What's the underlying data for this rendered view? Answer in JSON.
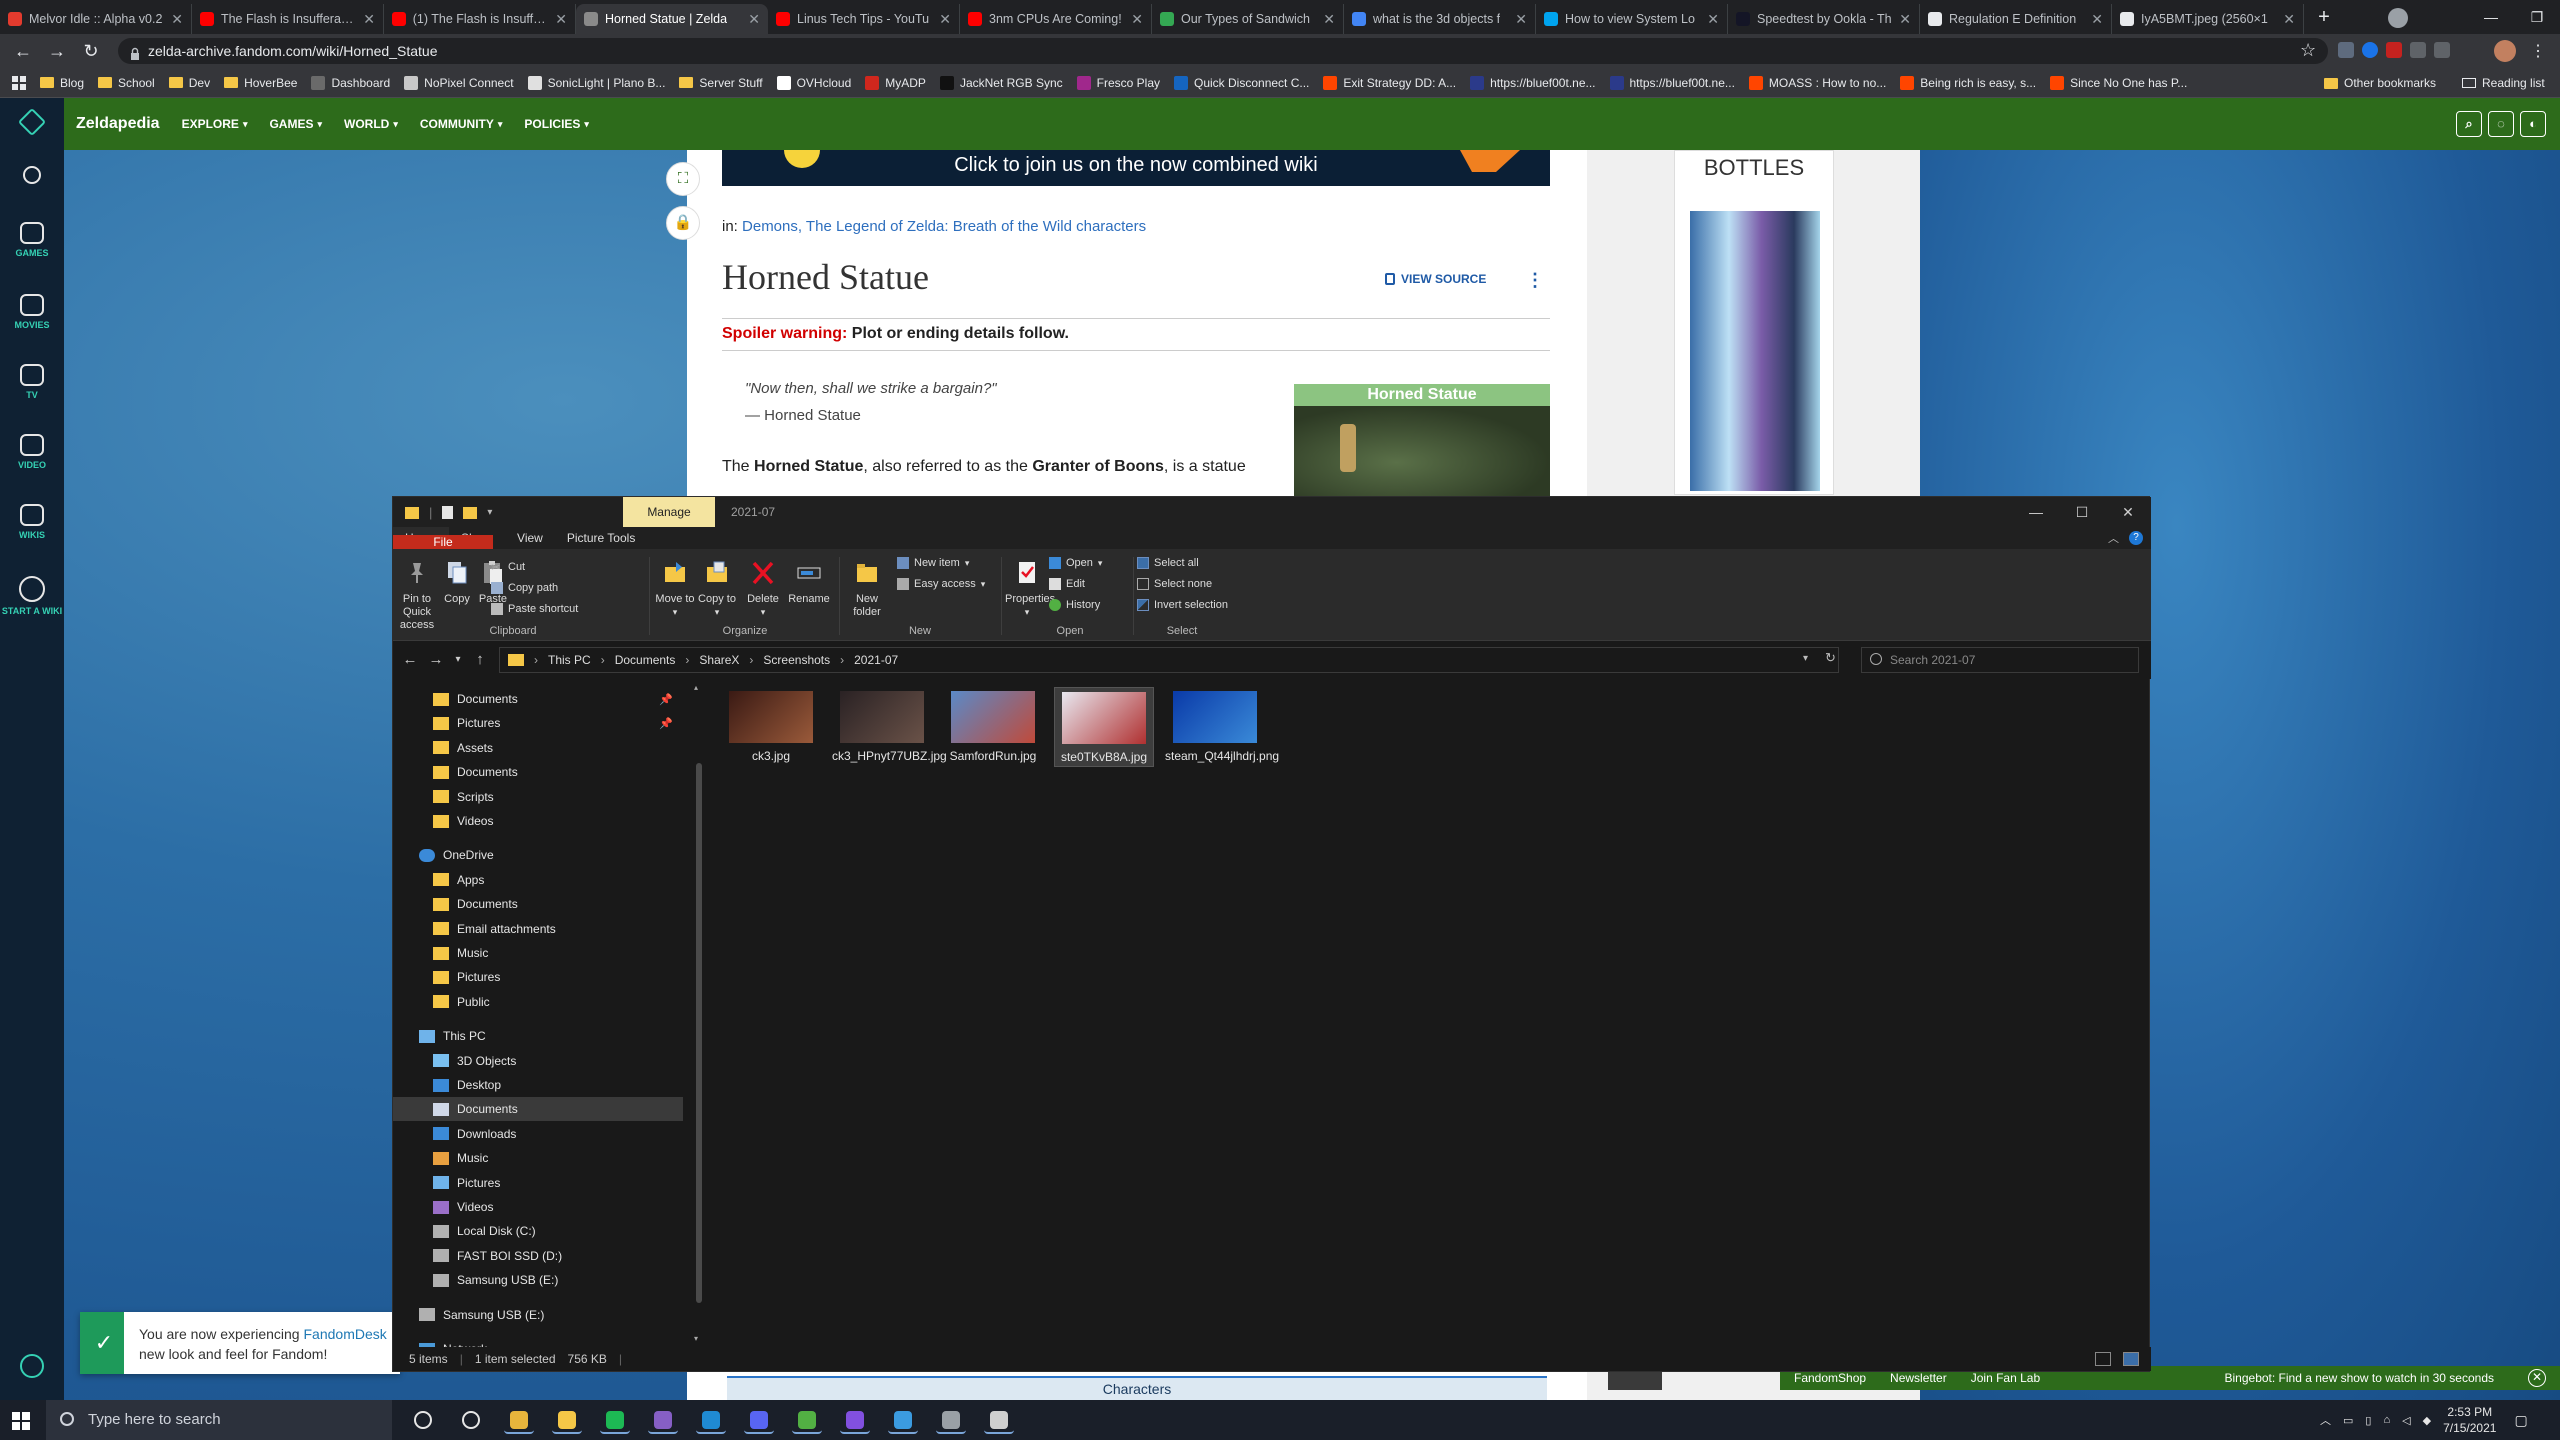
{
  "browser": {
    "tabs": [
      {
        "title": "Melvor Idle :: Alpha v0.2",
        "color": "#e33b2e",
        "active": false
      },
      {
        "title": "The Flash is Insufferably",
        "color": "#ff0000",
        "active": false
      },
      {
        "title": "(1) The Flash is Insuffera",
        "color": "#ff0000",
        "active": false
      },
      {
        "title": "Horned Statue | Zelda",
        "color": "#8a8a8a",
        "active": true
      },
      {
        "title": "Linus Tech Tips - YouTu",
        "color": "#ff0000",
        "active": false
      },
      {
        "title": "3nm CPUs Are Coming!",
        "color": "#ff0000",
        "active": false
      },
      {
        "title": "Our Types of Sandwich",
        "color": "#34a853",
        "active": false
      },
      {
        "title": "what is the 3d objects f",
        "color": "#4285f4",
        "active": false
      },
      {
        "title": "How to view System Lo",
        "color": "#00a4ef",
        "active": false
      },
      {
        "title": "Speedtest by Ookla - Th",
        "color": "#141526",
        "active": false
      },
      {
        "title": "Regulation E Definition",
        "color": "#e8eaed",
        "active": false
      },
      {
        "title": "IyA5BMT.jpeg (2560×1",
        "color": "#e8eaed",
        "active": false
      }
    ],
    "url": "zelda-archive.fandom.com/wiki/Horned_Statue",
    "bookmarks": [
      {
        "label": "Blog",
        "type": "folder"
      },
      {
        "label": "School",
        "type": "folder"
      },
      {
        "label": "Dev",
        "type": "folder"
      },
      {
        "label": "HoverBee",
        "type": "folder"
      },
      {
        "label": "Dashboard",
        "type": "site",
        "color": "#6a6a6a"
      },
      {
        "label": "NoPixel Connect",
        "type": "site",
        "color": "#c8c8c8"
      },
      {
        "label": "SonicLight | Plano B...",
        "type": "site",
        "color": "#e0e0e0"
      },
      {
        "label": "Server Stuff",
        "type": "folder"
      },
      {
        "label": "OVHcloud",
        "type": "site",
        "color": "#ffffff"
      },
      {
        "label": "MyADP",
        "type": "site",
        "color": "#d0271d"
      },
      {
        "label": "JackNet RGB Sync",
        "type": "site",
        "color": "#111111"
      },
      {
        "label": "Fresco Play",
        "type": "site",
        "color": "#a0288c"
      },
      {
        "label": "Quick Disconnect C...",
        "type": "site",
        "color": "#1565c0"
      },
      {
        "label": "Exit Strategy DD: A...",
        "type": "site",
        "color": "#ff4500"
      },
      {
        "label": "https://bluef00t.ne...",
        "type": "site",
        "color": "#2b3a8a"
      },
      {
        "label": "https://bluef00t.ne...",
        "type": "site",
        "color": "#2b3a8a"
      },
      {
        "label": "MOASS : How to no...",
        "type": "site",
        "color": "#ff4500"
      },
      {
        "label": "Being rich is easy, s...",
        "type": "site",
        "color": "#ff4500"
      },
      {
        "label": "Since No One has P...",
        "type": "site",
        "color": "#ff4500"
      }
    ],
    "other_bookmarks": "Other bookmarks",
    "reading_list": "Reading list"
  },
  "fandom": {
    "rail": [
      {
        "label": "",
        "icon": "fandom-heart-icon"
      },
      {
        "label": "",
        "icon": "search-icon"
      },
      {
        "label": "GAMES",
        "icon": "gamepad-icon"
      },
      {
        "label": "MOVIES",
        "icon": "film-icon"
      },
      {
        "label": "TV",
        "icon": "tv-icon"
      },
      {
        "label": "VIDEO",
        "icon": "video-icon"
      },
      {
        "label": "WIKIS",
        "icon": "wikis-icon"
      },
      {
        "label": "START A WIKI",
        "icon": "plus-circle-icon"
      }
    ],
    "wiki_name": "Zeldapedia",
    "nav": [
      "EXPLORE",
      "GAMES",
      "WORLD",
      "COMMUNITY",
      "POLICIES"
    ],
    "banner_text": "Click to join us on the now combined wiki",
    "categories_prefix": "in:",
    "categories": "Demons, The Legend of Zelda: Breath of the Wild characters",
    "page_title": "Horned Statue",
    "view_source": "VIEW SOURCE",
    "spoiler_label": "Spoiler warning:",
    "spoiler_text": "Plot or ending details follow.",
    "quote": "\"Now then, shall we strike a bargain?\"",
    "quote_attr": "— Horned Statue",
    "infobox_title": "Horned Statue",
    "intro_pre": "The ",
    "intro_b1": "Horned Statue",
    "intro_mid": ", also referred to as the ",
    "intro_b2": "Granter of Boons",
    "intro_post": ", is a statue",
    "ad_title": "BOTTLES",
    "bottom_links": [
      "FandomShop",
      "Newsletter",
      "Join Fan Lab"
    ],
    "bingebot": "Bingebot: Find a new show to watch in 30 seconds",
    "characters_bar": "Characters",
    "toast_line1_pre": "You are now experiencing ",
    "toast_link": "FandomDesk",
    "toast_line2": "new look and feel for Fandom!"
  },
  "explorer": {
    "title_path": "2021-07",
    "manage_tab": "Manage",
    "tabs": [
      "File",
      "Home",
      "Share",
      "View",
      "Picture Tools"
    ],
    "ribbon": {
      "clipboard": {
        "group": "Clipboard",
        "pin": "Pin to Quick access",
        "copy": "Copy",
        "paste": "Paste",
        "cut": "Cut",
        "copy_path": "Copy path",
        "paste_shortcut": "Paste shortcut"
      },
      "organize": {
        "group": "Organize",
        "move_to": "Move to",
        "copy_to": "Copy to",
        "delete": "Delete",
        "rename": "Rename"
      },
      "new": {
        "group": "New",
        "new_folder": "New folder",
        "new_item": "New item",
        "easy_access": "Easy access"
      },
      "open": {
        "group": "Open",
        "properties": "Properties",
        "open": "Open",
        "edit": "Edit",
        "history": "History"
      },
      "select": {
        "group": "Select",
        "select_all": "Select all",
        "select_none": "Select none",
        "invert": "Invert selection"
      }
    },
    "breadcrumb": [
      "This PC",
      "Documents",
      "ShareX",
      "Screenshots",
      "2021-07"
    ],
    "search_placeholder": "Search 2021-07",
    "nav": [
      {
        "label": "Documents",
        "icon": "folder-icon",
        "indent": 1,
        "pinned": true
      },
      {
        "label": "Pictures",
        "icon": "folder-icon",
        "indent": 1,
        "pinned": true
      },
      {
        "label": "Assets",
        "icon": "folder-icon",
        "indent": 1
      },
      {
        "label": "Documents",
        "icon": "folder-icon",
        "indent": 1
      },
      {
        "label": "Scripts",
        "icon": "folder-icon",
        "indent": 1
      },
      {
        "label": "Videos",
        "icon": "folder-icon",
        "indent": 1
      },
      {
        "label": "",
        "spacer": true
      },
      {
        "label": "OneDrive",
        "icon": "cloud-icon",
        "indent": 0
      },
      {
        "label": "Apps",
        "icon": "folder-icon",
        "indent": 1
      },
      {
        "label": "Documents",
        "icon": "folder-icon",
        "indent": 1
      },
      {
        "label": "Email attachments",
        "icon": "folder-icon",
        "indent": 1
      },
      {
        "label": "Music",
        "icon": "folder-icon",
        "indent": 1
      },
      {
        "label": "Pictures",
        "icon": "folder-icon",
        "indent": 1
      },
      {
        "label": "Public",
        "icon": "folder-icon",
        "indent": 1
      },
      {
        "label": "",
        "spacer": true
      },
      {
        "label": "This PC",
        "icon": "pc-icon",
        "indent": 0
      },
      {
        "label": "3D Objects",
        "icon": "cube-icon",
        "indent": 1
      },
      {
        "label": "Desktop",
        "icon": "desktop-icon",
        "indent": 1
      },
      {
        "label": "Documents",
        "icon": "documents-icon",
        "indent": 1,
        "selected": true
      },
      {
        "label": "Downloads",
        "icon": "download-icon",
        "indent": 1
      },
      {
        "label": "Music",
        "icon": "music-icon",
        "indent": 1
      },
      {
        "label": "Pictures",
        "icon": "pictures-icon",
        "indent": 1
      },
      {
        "label": "Videos",
        "icon": "videos-icon",
        "indent": 1
      },
      {
        "label": "Local Disk (C:)",
        "icon": "drive-icon",
        "indent": 1
      },
      {
        "label": "FAST BOI SSD (D:)",
        "icon": "drive-icon",
        "indent": 1
      },
      {
        "label": "Samsung USB (E:)",
        "icon": "usb-drive-icon",
        "indent": 1
      },
      {
        "label": "",
        "spacer": true
      },
      {
        "label": "Samsung USB (E:)",
        "icon": "usb-drive-icon",
        "indent": 0
      },
      {
        "label": "",
        "spacer": true
      },
      {
        "label": "Network",
        "icon": "network-icon",
        "indent": 0
      }
    ],
    "files": [
      {
        "name": "ck3.jpg",
        "colors": [
          "#3a1a14",
          "#9a5a3a"
        ],
        "selected": false
      },
      {
        "name": "ck3_HPnyt77UBZ.jpg",
        "colors": [
          "#2a2224",
          "#6a5248"
        ],
        "selected": false
      },
      {
        "name": "SamfordRun.jpg",
        "colors": [
          "#5a8ac8",
          "#c04a3a"
        ],
        "selected": false
      },
      {
        "name": "ste0TKvB8A.jpg",
        "colors": [
          "#e8e8f0",
          "#b03030"
        ],
        "selected": true
      },
      {
        "name": "steam_Qt44jlhdrj.png",
        "colors": [
          "#0a3aa8",
          "#3a8ad8"
        ],
        "selected": false
      }
    ],
    "status": {
      "items": "5 items",
      "selected": "1 item selected",
      "size": "756 KB"
    }
  },
  "taskbar": {
    "search_placeholder": "Type here to search",
    "apps": [
      {
        "name": "cortana-icon",
        "color": "#1a1f29",
        "running": false
      },
      {
        "name": "task-view-icon",
        "color": "#1a1f29",
        "running": false
      },
      {
        "name": "chrome-icon",
        "color": "#e8b53c",
        "running": true
      },
      {
        "name": "file-explorer-icon",
        "color": "#f5c747",
        "running": true
      },
      {
        "name": "spotify-icon",
        "color": "#1db954",
        "running": true
      },
      {
        "name": "visual-studio-icon",
        "color": "#865fc5",
        "running": true
      },
      {
        "name": "vscode-icon",
        "color": "#1f8ad2",
        "running": true
      },
      {
        "name": "discord-icon",
        "color": "#5865f2",
        "running": true
      },
      {
        "name": "xbox-icon",
        "color": "#52b043",
        "running": true
      },
      {
        "name": "github-icon",
        "color": "#8250df",
        "running": true
      },
      {
        "name": "sharex-icon",
        "color": "#3b9be0",
        "running": true
      },
      {
        "name": "settings-icon",
        "color": "#9aa0a6",
        "running": true
      },
      {
        "name": "sound-icon",
        "color": "#cfcfcf",
        "running": true
      }
    ],
    "time": "2:53 PM",
    "date": "7/15/2021"
  }
}
